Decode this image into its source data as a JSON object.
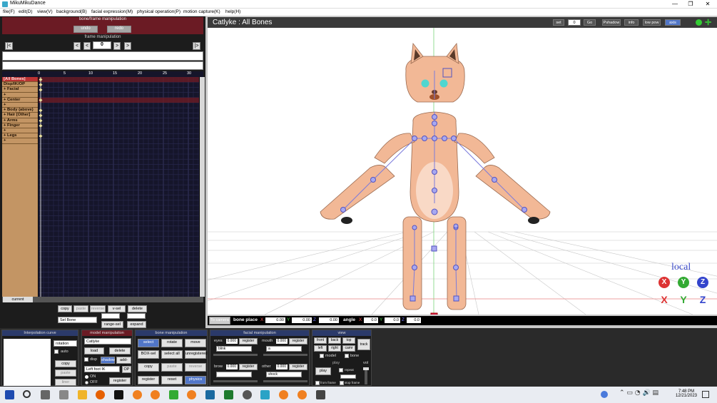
{
  "window": {
    "title": "MikuMikuDance",
    "min": "—",
    "max": "❐",
    "close": "✕"
  },
  "menu": [
    "file(F)",
    "edit(D)",
    "view(V)",
    "background(B)",
    "facial expression(M)",
    "physical operation(P)",
    "motion capture(K)",
    "help(H)"
  ],
  "left": {
    "bf_title": "bone/frame manipulation",
    "undo": "undo",
    "redo": "redo",
    "fm_title": "frame manipulation",
    "frame": "0",
    "nav": [
      "|<",
      "<",
      "<",
      "0",
      ">",
      ">",
      "|>"
    ],
    "bones": [
      "[All Bones]",
      "Disp/IK/OP",
      "+ Facial",
      "+",
      "+ Center",
      "+",
      "+ Body (above)",
      "+ Hair [Other]",
      "+ Arms",
      "+ Finger",
      "+",
      "+ Legs",
      "+"
    ],
    "ruler": [
      "0",
      "5",
      "10",
      "15",
      "20",
      "25",
      "30"
    ],
    "current": "current",
    "copy": "copy",
    "paste": "paste",
    "reverse": "reverse",
    "vsel": "v-sel",
    "delete": "delete",
    "selbone": "Sel Bone",
    "rangesel": "range-sel",
    "expand": "expand"
  },
  "viewport": {
    "title": "Catlyke : All Bones",
    "set": "set",
    "setval": "0",
    "go": "Go",
    "pshadow": "Pshadow",
    "info": "info",
    "lowpow": "low pow",
    "axis": "axis",
    "local": "local",
    "axes_top": [
      "X",
      "Y",
      "Z"
    ],
    "axes_bottom": [
      "X",
      "Y",
      "Z"
    ]
  },
  "bonebar": {
    "tocamera": "To camera",
    "boneplace": "bone place",
    "x": "0.00",
    "y": "0.00",
    "z": "0.00",
    "angle": "angle",
    "ax": "0.0",
    "ay": "0.0",
    "az": "0.0",
    "lx": "X",
    "ly": "Y",
    "lz": "Z"
  },
  "interp": {
    "title": "Interpolation curve",
    "rotation": "rotation",
    "auto": "auto",
    "copy": "copy",
    "paste": "paste",
    "liner": "liner"
  },
  "model": {
    "title": "model manipulation",
    "name": "Catlyke",
    "load": "load",
    "delete": "delete",
    "disp": "disp",
    "shadow": "shadow",
    "addsyn": "add-syn",
    "parent": "Left foot IK",
    "op": "OP",
    "on": "ON",
    "off": "OFF",
    "register": "register"
  },
  "bone": {
    "title": "bone manipulation",
    "select": "select",
    "rotate": "rotate",
    "move": "move",
    "boxsel": "BOX-sel",
    "selectall": "select all",
    "unregist": "unregistered",
    "copy": "copy",
    "paste": "paste",
    "reverse": "reverse",
    "register": "register",
    "reset": "reset",
    "physics": "physics"
  },
  "facial": {
    "title": "facial manipulation",
    "eyes": "eyes",
    "mouth": "mouth",
    "brow": "brow",
    "other": "other",
    "eyesv": "0.000",
    "mouthv": "0.000",
    "browv": "0.000",
    "otherv": "0.000",
    "register": "register",
    "eyesd": "blink",
    "mouthd": "a",
    "browd": "",
    "otherd": "shock"
  },
  "view": {
    "title": "view",
    "front": "front",
    "back": "back",
    "top": "top",
    "left": "left",
    "right": "right",
    "camr": "camr",
    "track": "track",
    "model": "model",
    "bone": "bone",
    "play": "play",
    "playbtn": "play",
    "repeat": "repeat",
    "fromframe": "from frame",
    "stopframe": "stop frame",
    "vol": "vol"
  },
  "taskbar": {
    "time": "7:48 PM",
    "date": "12/21/2023"
  },
  "colors": {
    "panel_red": "#6b1b24",
    "grid": "#15152a",
    "bone": "#7b7bdc",
    "skin": "#f2b896",
    "accent": "#5176c8"
  }
}
